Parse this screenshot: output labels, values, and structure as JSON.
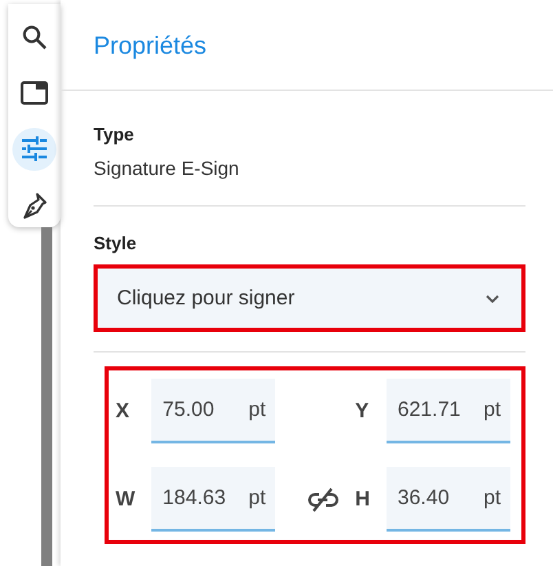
{
  "toolbar": {
    "tools": [
      {
        "kind": "search",
        "selected": false
      },
      {
        "kind": "panel",
        "selected": false
      },
      {
        "kind": "sliders",
        "selected": true
      },
      {
        "kind": "pen",
        "selected": false
      }
    ]
  },
  "panel": {
    "title": "Propriétés",
    "type": {
      "label": "Type",
      "value": "Signature E-Sign"
    },
    "style": {
      "label": "Style",
      "value": "Cliquez pour signer",
      "highlighted": true
    },
    "geometry": {
      "highlighted": true,
      "aspect_locked": false,
      "fields": [
        {
          "label": "X",
          "value": "75.00",
          "unit": "pt"
        },
        {
          "label": "Y",
          "value": "621.71",
          "unit": "pt"
        },
        {
          "label": "W",
          "value": "184.63",
          "unit": "pt"
        },
        {
          "label": "H",
          "value": "36.40",
          "unit": "pt"
        }
      ]
    }
  }
}
